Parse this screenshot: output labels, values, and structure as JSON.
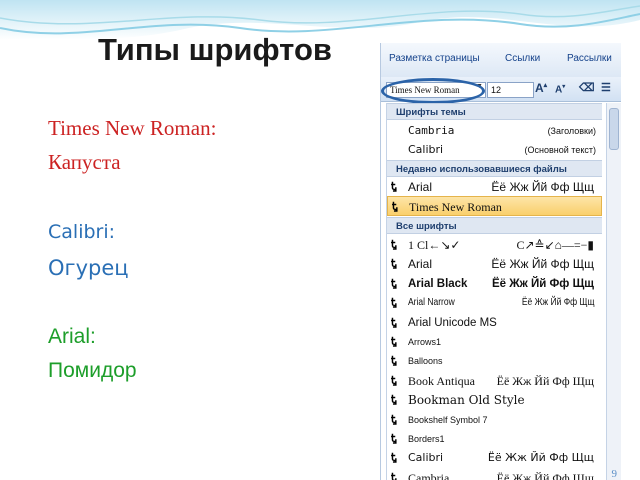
{
  "slide": {
    "title": "Типы шрифтов",
    "samples": [
      {
        "font": "Times New Roman:",
        "word": "Капуста"
      },
      {
        "font": "Calibri:",
        "word": "Огурец"
      },
      {
        "font": "Arial:",
        "word": "Помидор"
      }
    ],
    "page_number": "9"
  },
  "ribbon": {
    "tabs": [
      "Разметка страницы",
      "Ссылки",
      "Рассылки"
    ],
    "font_name": "Times New Roman",
    "font_size": "12"
  },
  "dropdown": {
    "section_theme": "Шрифты темы",
    "theme_fonts": [
      {
        "name": "Cambria",
        "note": "(Заголовки)"
      },
      {
        "name": "Calibri",
        "note": "(Основной текст)"
      }
    ],
    "section_recent": "Недавно использовавшиеся файлы",
    "recent_fonts": [
      {
        "name": "Arial",
        "preview": "Ёё Жж Йй Фф Щщ"
      },
      {
        "name": "Times New Roman",
        "preview": ""
      }
    ],
    "section_all": "Все шрифты",
    "all_fonts": [
      {
        "name": "1 Cl←↘✓",
        "preview": "C↗≙↙⌂—=−▮"
      },
      {
        "name": "Arial",
        "preview": "Ёё Жж Йй Фф Щщ"
      },
      {
        "name": "Arial Black",
        "preview": "Ёё Жж Йй Фф Щщ"
      },
      {
        "name": "Arial Narrow",
        "preview": "Ёё Жж Йй Фф Щщ"
      },
      {
        "name": "Arial Unicode MS",
        "preview": ""
      },
      {
        "name": "Arrows1",
        "preview": ""
      },
      {
        "name": "Balloons",
        "preview": ""
      },
      {
        "name": "Book Antiqua",
        "preview": "Ёё Жж Йй Фф Щщ"
      },
      {
        "name": "Bookman Old Style",
        "preview": ""
      },
      {
        "name": "Bookshelf Symbol 7",
        "preview": ""
      },
      {
        "name": "Borders1",
        "preview": ""
      },
      {
        "name": "Calibri",
        "preview": "Ёё Жж Йй Фф Щщ"
      },
      {
        "name": "Cambria",
        "preview": "Ёё Жж Йй Фф Щщ"
      }
    ]
  },
  "colors": {
    "highlight": "#f9cf6c",
    "accent": "#2b63a8",
    "title": "#1a1a1a"
  },
  "icons": [
    "truetype-font-icon",
    "grow-font-icon",
    "shrink-font-icon",
    "list-icon",
    "dropdown-arrow-icon"
  ]
}
